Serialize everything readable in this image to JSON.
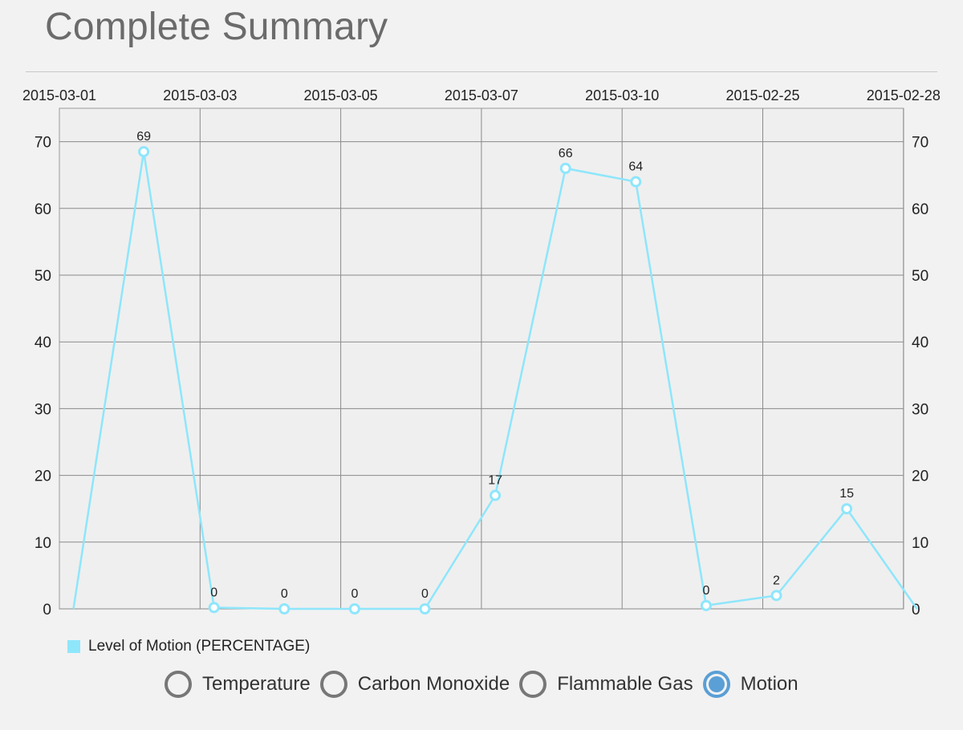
{
  "header": {
    "title": "Complete Summary"
  },
  "chart_data": {
    "type": "line",
    "x_tick_labels": [
      "2015-03-01",
      "2015-03-03",
      "2015-03-05",
      "2015-03-07",
      "2015-03-10",
      "2015-02-25",
      "2015-02-28"
    ],
    "y_ticks": [
      0,
      10,
      20,
      30,
      40,
      50,
      60,
      70
    ],
    "ylim": [
      0,
      75
    ],
    "y_axis_right": true,
    "grid": true,
    "series": [
      {
        "name": "Level of  Motion (PERCENTAGE)",
        "color": "#8ee6fb",
        "values": [
          0,
          68.5,
          0.2,
          0,
          0,
          0,
          17,
          66,
          64,
          0.5,
          2,
          15,
          0
        ],
        "point_labels": [
          null,
          "69",
          "0",
          "0",
          "0",
          "0",
          "17",
          "66",
          "64",
          "0",
          "2",
          "15",
          null
        ]
      }
    ],
    "legend_position": "bottom-left"
  },
  "radio_group": {
    "options": [
      {
        "label": "Temperature",
        "checked": false
      },
      {
        "label": "Carbon Monoxide",
        "checked": false
      },
      {
        "label": "Flammable Gas",
        "checked": false
      },
      {
        "label": "Motion",
        "checked": true
      }
    ]
  },
  "colors": {
    "accent": "#5a9fd6",
    "series": "#8ee6fb"
  }
}
